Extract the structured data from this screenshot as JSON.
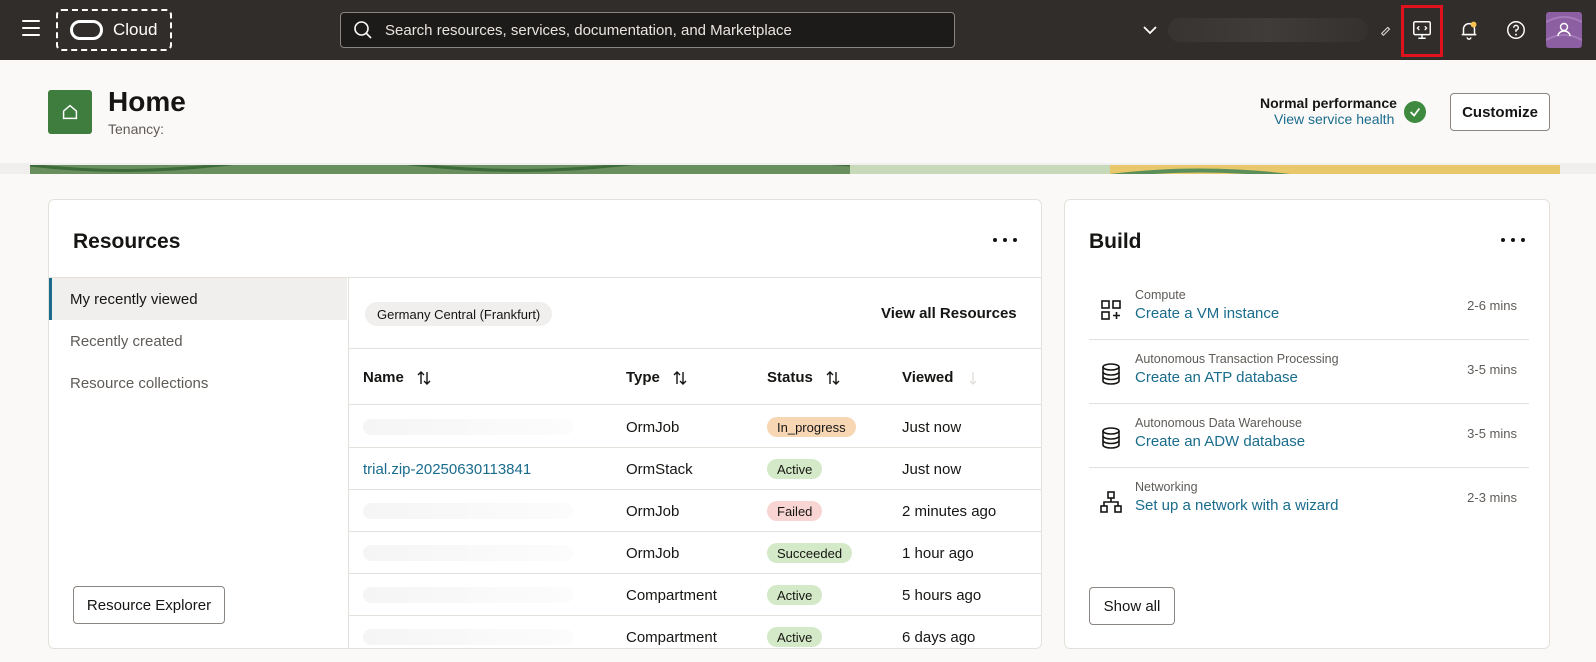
{
  "topbar": {
    "logo_text": "Cloud",
    "search_placeholder": "Search resources, services, documentation, and Marketplace",
    "icons": [
      "menu-icon",
      "chevron-down-icon",
      "cloud-shell-icon",
      "bell-icon",
      "help-icon",
      "user-icon"
    ]
  },
  "header": {
    "title": "Home",
    "tenancy_label": "Tenancy: ",
    "perf_label": "Normal performance",
    "perf_link": "View service health",
    "customize_label": "Customize"
  },
  "resources": {
    "title": "Resources",
    "nav": [
      "My recently viewed",
      "Recently created",
      "Resource collections"
    ],
    "explorer_label": "Resource Explorer",
    "region_chip": "Germany Central (Frankfurt)",
    "view_all_label": "View all Resources",
    "columns": [
      "Name",
      "Type",
      "Status",
      "Viewed"
    ],
    "rows": [
      {
        "name": "",
        "type": "OrmJob",
        "status": "In_progress",
        "viewed": "Just now"
      },
      {
        "name": "trial.zip-20250630113841",
        "type": "OrmStack",
        "status": "Active",
        "viewed": "Just now"
      },
      {
        "name": "",
        "type": "OrmJob",
        "status": "Failed",
        "viewed": "2 minutes ago"
      },
      {
        "name": "",
        "type": "OrmJob",
        "status": "Succeeded",
        "viewed": "1 hour ago"
      },
      {
        "name": "",
        "type": "Compartment",
        "status": "Active",
        "viewed": "5 hours ago"
      },
      {
        "name": "",
        "type": "Compartment",
        "status": "Active",
        "viewed": "6 days ago"
      }
    ]
  },
  "build": {
    "title": "Build",
    "items": [
      {
        "category": "Compute",
        "link": "Create a VM instance",
        "time": "2-6 mins",
        "icon": "compute-icon"
      },
      {
        "category": "Autonomous Transaction Processing",
        "link": "Create an ATP database",
        "time": "3-5 mins",
        "icon": "database-icon"
      },
      {
        "category": "Autonomous Data Warehouse",
        "link": "Create an ADW database",
        "time": "3-5 mins",
        "icon": "database-icon"
      },
      {
        "category": "Networking",
        "link": "Set up a network with a wizard",
        "time": "2-3 mins",
        "icon": "network-icon"
      }
    ],
    "show_all_label": "Show all"
  },
  "status_colors": {
    "In_progress": "#f7d6b4",
    "Active": "#d4e9c8",
    "Failed": "#f8d5d2",
    "Succeeded": "#d4e9c8"
  }
}
